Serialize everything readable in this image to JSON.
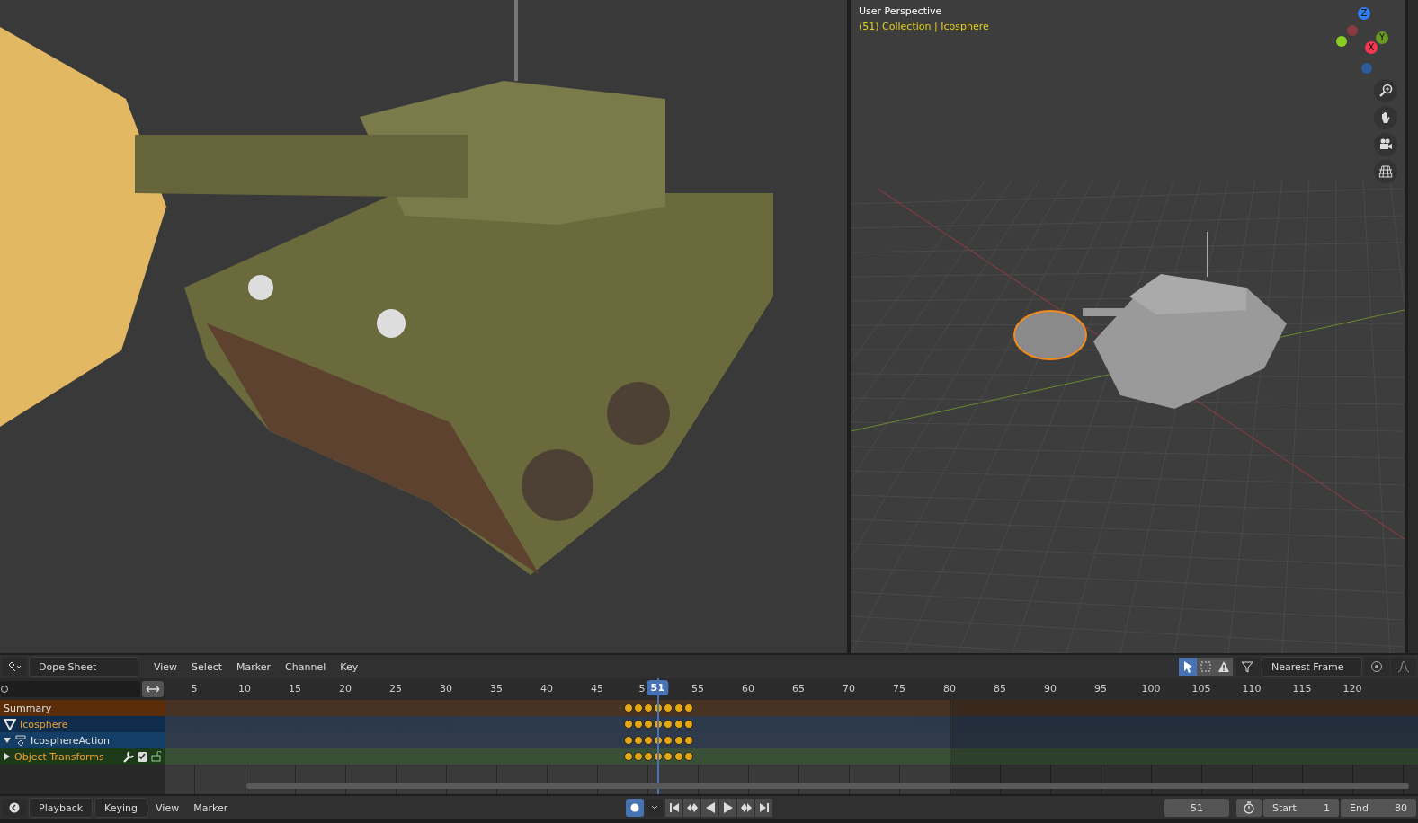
{
  "viewport_right": {
    "title": "User Perspective",
    "context": "(51) Collection | Icosphere",
    "gizmo": [
      {
        "label": "Z",
        "color": "#2f7ef5"
      },
      {
        "label": "Y",
        "color": "#6a9a23"
      },
      {
        "label": "X",
        "color": "#f5374f"
      }
    ]
  },
  "dopesheet": {
    "editor_type": "Dope Sheet",
    "menus": [
      "View",
      "Select",
      "Marker",
      "Channel",
      "Key"
    ],
    "tools": [
      {
        "kind": "select",
        "selected": true
      },
      {
        "kind": "box",
        "selected": false
      },
      {
        "kind": "warning",
        "selected": false
      }
    ],
    "snap": "Nearest Frame",
    "ruler": [
      "5",
      "10",
      "15",
      "20",
      "25",
      "30",
      "35",
      "40",
      "45",
      "5",
      "55",
      "60",
      "65",
      "70",
      "75",
      "80",
      "85",
      "90",
      "95",
      "100",
      "105",
      "110",
      "115",
      "120"
    ],
    "current_frame": "51",
    "channels": [
      {
        "kind": "summary",
        "label": "Summary"
      },
      {
        "kind": "object",
        "label": "Icosphere"
      },
      {
        "kind": "action",
        "label": "IcosphereAction",
        "expanded": true
      },
      {
        "kind": "group",
        "label": "Object Transforms",
        "expanded": false,
        "checked": true
      }
    ]
  },
  "timeline": {
    "dropdowns": [
      "Playback",
      "Keying"
    ],
    "menus": [
      "View",
      "Marker"
    ],
    "auto_key_on": true,
    "current_frame": "51",
    "start_label": "Start",
    "start": "1",
    "end_label": "End",
    "end": "80"
  }
}
